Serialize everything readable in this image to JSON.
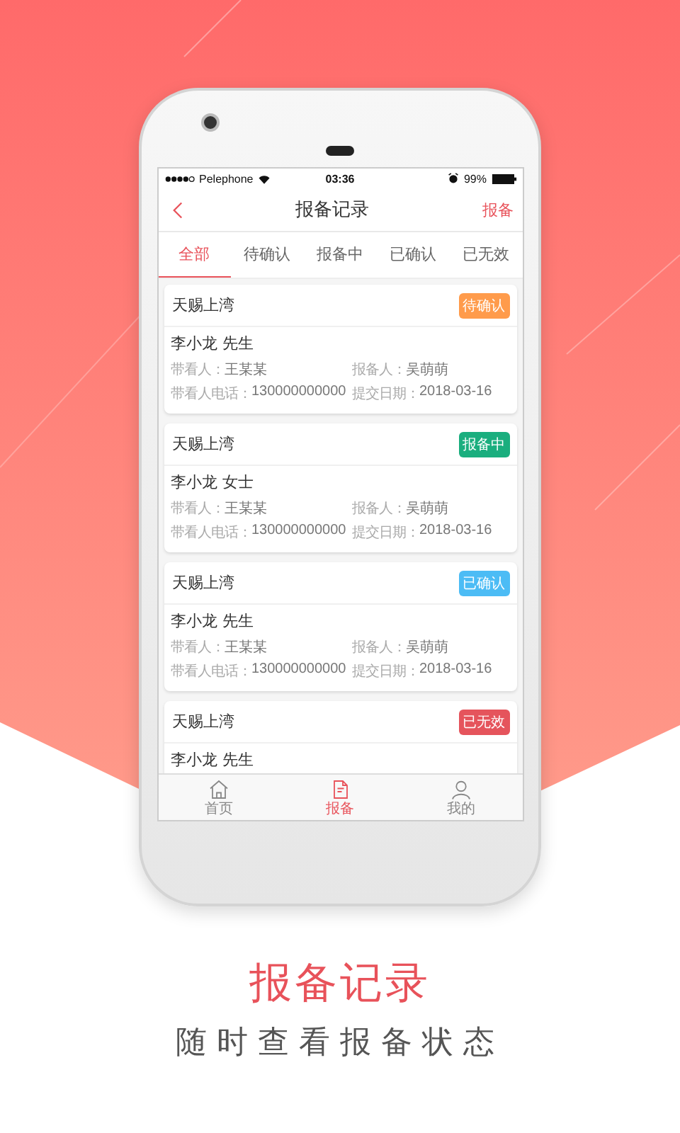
{
  "status_bar": {
    "carrier": "Pelephone",
    "time": "03:36",
    "battery": "99%"
  },
  "nav": {
    "title": "报备记录",
    "action": "报备"
  },
  "tabs": [
    {
      "label": "全部",
      "selected": true
    },
    {
      "label": "待确认",
      "selected": false
    },
    {
      "label": "报备中",
      "selected": false
    },
    {
      "label": "已确认",
      "selected": false
    },
    {
      "label": "已无效",
      "selected": false
    }
  ],
  "records": [
    {
      "project": "天赐上湾",
      "status": "待确认",
      "color": "#ff9b4b",
      "name": "李小龙 先生",
      "fields": [
        {
          "label": "带看人：",
          "value": "王某某"
        },
        {
          "label": "报备人：",
          "value": "吴萌萌"
        },
        {
          "label": "带看人电话：",
          "value": "130000000000"
        },
        {
          "label": "提交日期：",
          "value": "2018-03-16"
        }
      ]
    },
    {
      "project": "天赐上湾",
      "status": "报备中",
      "color": "#1aae7e",
      "name": "李小龙 女士",
      "fields": [
        {
          "label": "带看人：",
          "value": "王某某"
        },
        {
          "label": "报备人：",
          "value": "吴萌萌"
        },
        {
          "label": "带看人电话：",
          "value": "130000000000"
        },
        {
          "label": "提交日期：",
          "value": "2018-03-16"
        }
      ]
    },
    {
      "project": "天赐上湾",
      "status": "已确认",
      "color": "#4cbcf5",
      "name": "李小龙 先生",
      "fields": [
        {
          "label": "带看人：",
          "value": "王某某"
        },
        {
          "label": "报备人：",
          "value": "吴萌萌"
        },
        {
          "label": "带看人电话：",
          "value": "130000000000"
        },
        {
          "label": "提交日期：",
          "value": "2018-03-16"
        }
      ]
    },
    {
      "project": "天赐上湾",
      "status": "已无效",
      "color": "#e5545c",
      "name": "李小龙 先生"
    }
  ],
  "tab_bar": [
    {
      "label": "首页",
      "selected": false
    },
    {
      "label": "报备",
      "selected": true
    },
    {
      "label": "我的",
      "selected": false
    }
  ],
  "caption": {
    "title": "报备记录",
    "subtitle": "随时查看报备状态"
  }
}
